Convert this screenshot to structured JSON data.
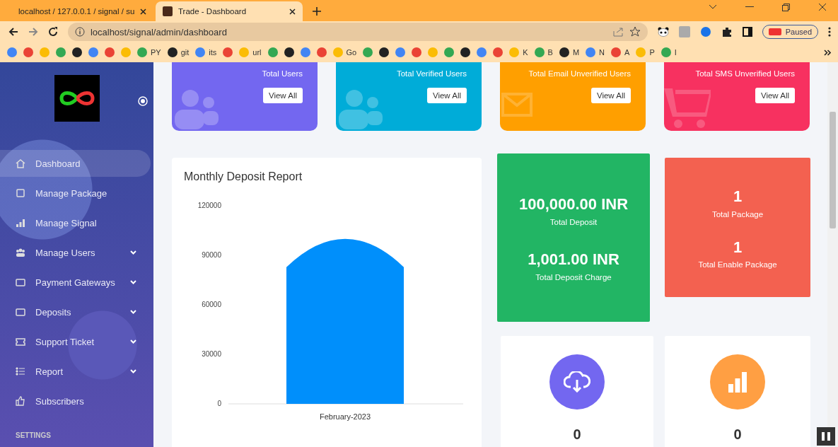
{
  "browser": {
    "tabs": [
      {
        "title": "localhost / 127.0.0.1 / signal / su",
        "selected": false
      },
      {
        "title": "Trade - Dashboard",
        "selected": true
      }
    ],
    "address": "localhost/signal/admin/dashboard",
    "profile": "Paused",
    "bookmarks": [
      {
        "kind": "icon"
      },
      {
        "kind": "icon"
      },
      {
        "kind": "icon"
      },
      {
        "kind": "icon"
      },
      {
        "kind": "icon"
      },
      {
        "kind": "icon"
      },
      {
        "kind": "icon"
      },
      {
        "kind": "icon"
      },
      {
        "kind": "labeled",
        "label": "PY"
      },
      {
        "kind": "labeled",
        "label": "git"
      },
      {
        "kind": "labeled",
        "label": "its"
      },
      {
        "kind": "icon"
      },
      {
        "kind": "labeled",
        "label": "url"
      },
      {
        "kind": "icon"
      },
      {
        "kind": "icon"
      },
      {
        "kind": "icon"
      },
      {
        "kind": "icon"
      },
      {
        "kind": "labeled",
        "label": "Go"
      },
      {
        "kind": "icon"
      },
      {
        "kind": "icon"
      },
      {
        "kind": "icon"
      },
      {
        "kind": "icon"
      },
      {
        "kind": "icon"
      },
      {
        "kind": "icon"
      },
      {
        "kind": "icon"
      },
      {
        "kind": "icon"
      },
      {
        "kind": "icon"
      },
      {
        "kind": "labeled",
        "label": "K"
      },
      {
        "kind": "labeled",
        "label": "B"
      },
      {
        "kind": "labeled",
        "label": "M"
      },
      {
        "kind": "labeled",
        "label": "N"
      },
      {
        "kind": "labeled",
        "label": "A"
      },
      {
        "kind": "labeled",
        "label": "P"
      },
      {
        "kind": "labeled",
        "label": "I"
      }
    ]
  },
  "sidebar": {
    "items": [
      {
        "label": "Dashboard",
        "expandable": false,
        "selected": true
      },
      {
        "label": "Manage Package",
        "expandable": false,
        "selected": false
      },
      {
        "label": "Manage Signal",
        "expandable": false,
        "selected": false
      },
      {
        "label": "Manage Users",
        "expandable": true,
        "selected": false
      },
      {
        "label": "Payment Gateways",
        "expandable": true,
        "selected": false
      },
      {
        "label": "Deposits",
        "expandable": true,
        "selected": false
      },
      {
        "label": "Support Ticket",
        "expandable": true,
        "selected": false
      },
      {
        "label": "Report",
        "expandable": true,
        "selected": false
      },
      {
        "label": "Subscribers",
        "expandable": false,
        "selected": false
      }
    ],
    "section": "SETTINGS"
  },
  "stat_cards": [
    {
      "label": "Total Users",
      "button": "View All",
      "color": "#7367f0"
    },
    {
      "label": "Total Verified Users",
      "button": "View All",
      "color": "#00acd8"
    },
    {
      "label": "Total Email Unverified Users",
      "button": "View All",
      "color": "#ff9f00"
    },
    {
      "label": "Total SMS Unverified Users",
      "button": "View All",
      "color": "#f73160"
    }
  ],
  "chart_panel": {
    "title": "Monthly Deposit Report",
    "chart_data": {
      "type": "bar",
      "categories": [
        "February-2023"
      ],
      "values": [
        100000
      ],
      "ylim": [
        0,
        120000
      ],
      "yticks": [
        0,
        30000,
        60000,
        90000,
        120000
      ]
    }
  },
  "deposit_card": {
    "amount": "100,000.00 INR",
    "label": "Total Deposit",
    "charge": "1,001.00 INR",
    "charge_label": "Total Deposit Charge"
  },
  "package_card": {
    "total": "1",
    "total_label": "Total Package",
    "enabled": "1",
    "enabled_label": "Total Enable Package"
  },
  "mini_cards": [
    {
      "color": "#7367f0",
      "value": "0"
    },
    {
      "color": "#ff9f43",
      "value": "0"
    }
  ]
}
